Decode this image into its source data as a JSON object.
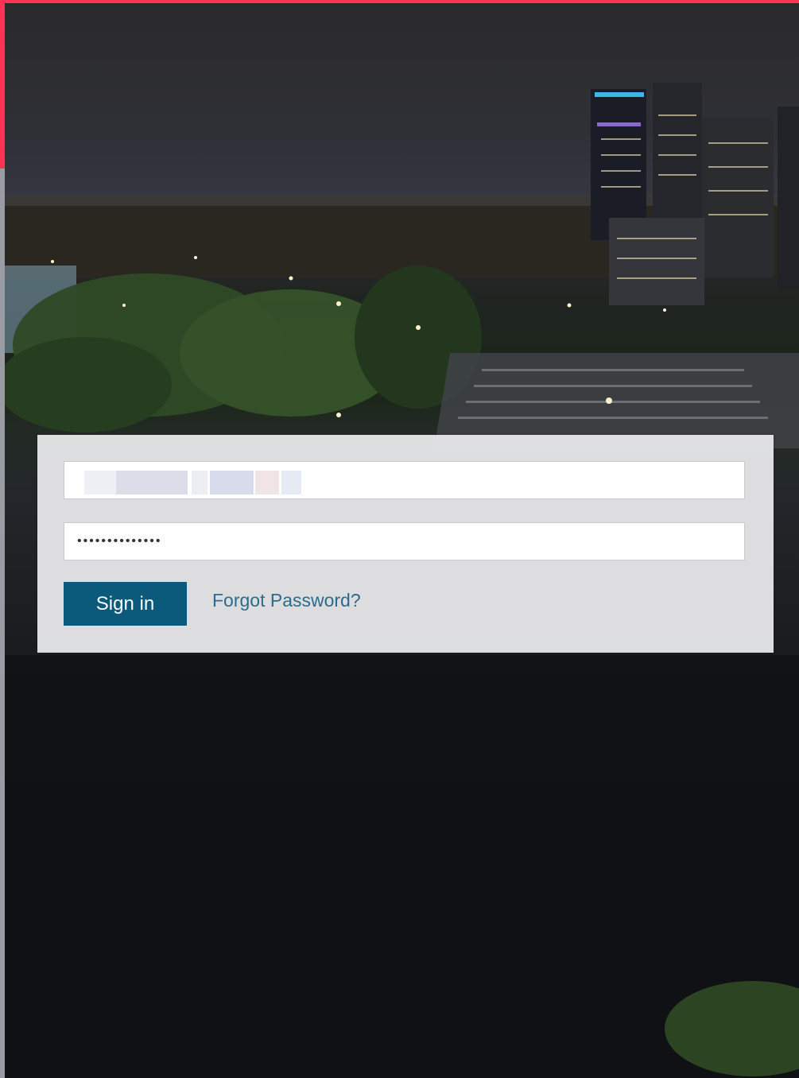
{
  "login": {
    "username_value": "",
    "password_value": "••••••••••••••",
    "signin_label": "Sign in",
    "forgot_label": "Forgot Password?"
  },
  "colors": {
    "accent": "#ff3355",
    "button": "#0b5a7c",
    "link": "#2a6c8c"
  }
}
